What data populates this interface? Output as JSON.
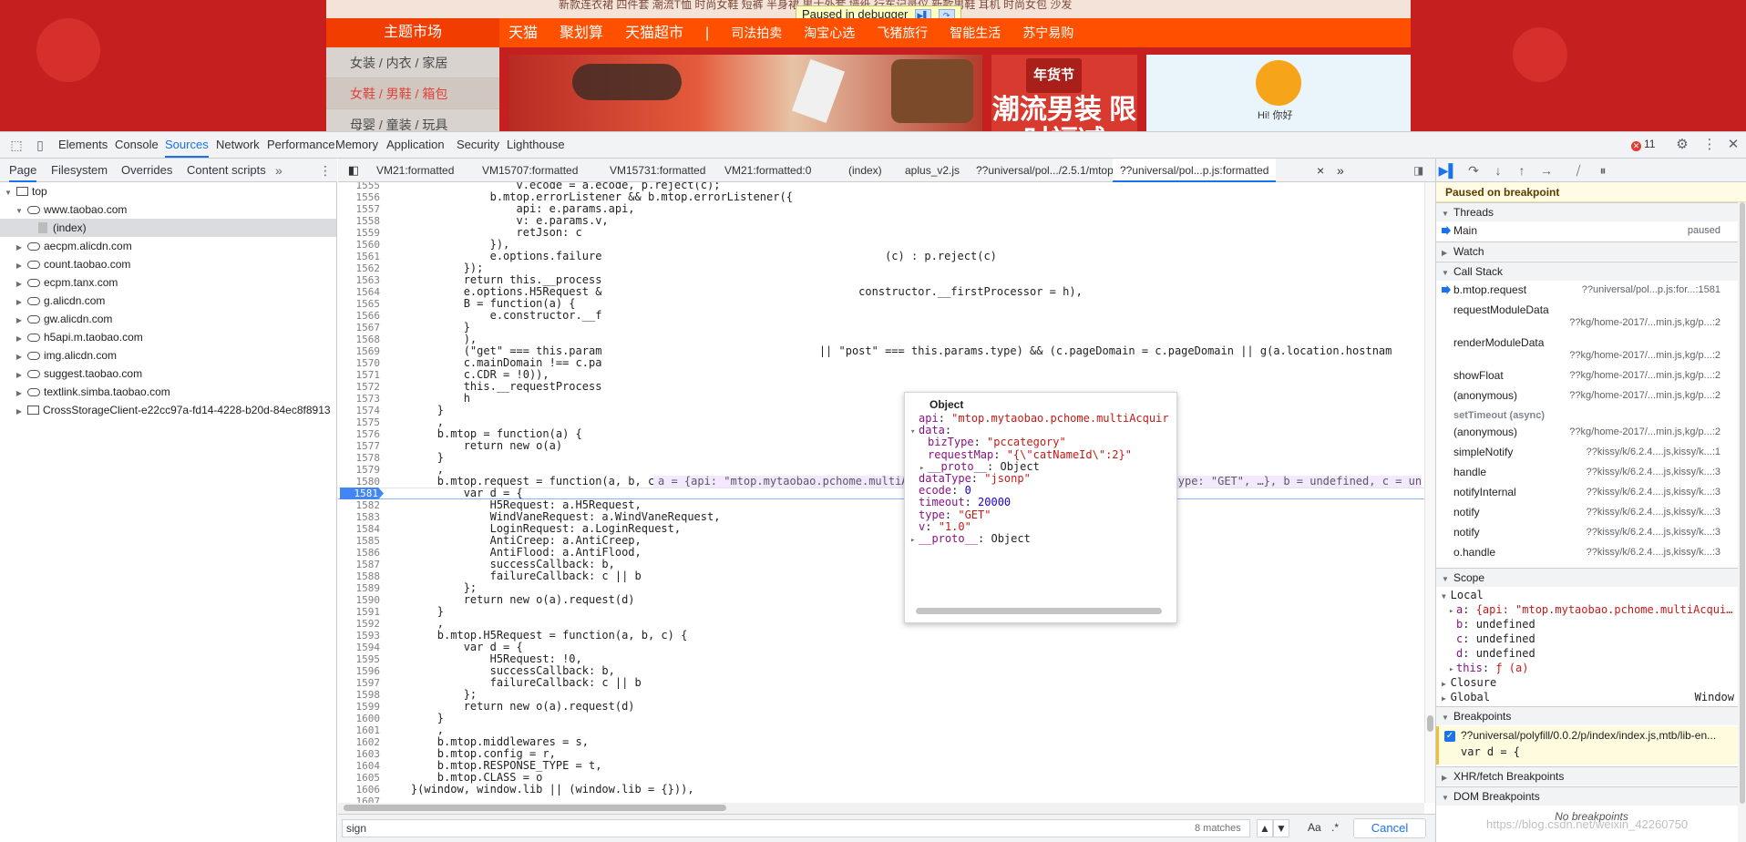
{
  "site": {
    "top_text": "新款连衣裙 四件套 潮流T恤 时尚女鞋 短裤 半身裙 男士外套 墙纸 行车记录仪 新款男鞋 耳机 时尚女包 沙发",
    "debugger_banner": "Paused in debugger",
    "theme_market": "主题市场",
    "nav_items": [
      "天猫",
      "聚划算",
      "天猫超市",
      "|",
      "司法拍卖",
      "淘宝心选",
      "飞猪旅行",
      "智能生活",
      "苏宁易购"
    ],
    "categories": [
      "女装 / 内衣 / 家居",
      "女鞋 / 男鞋 / 箱包",
      "母婴 / 童装 / 玩具"
    ],
    "banner2_tag": "年货节",
    "banner2_text": "潮流男装 限时福减",
    "banner3_hi": "Hi! 你好"
  },
  "devtools": {
    "tabs": [
      "Elements",
      "Console",
      "Sources",
      "Network",
      "Performance",
      "Memory",
      "Application",
      "Security",
      "Lighthouse"
    ],
    "selected_tab": "Sources",
    "error_count": "11",
    "navigator_tabs": [
      "Page",
      "Filesystem",
      "Overrides",
      "Content scripts"
    ],
    "tree": [
      {
        "label": "top",
        "depth": 0,
        "kind": "frame",
        "open": true
      },
      {
        "label": "www.taobao.com",
        "depth": 1,
        "kind": "cloud",
        "open": true
      },
      {
        "label": "(index)",
        "depth": 2,
        "kind": "file",
        "selected": true
      },
      {
        "label": "aecpm.alicdn.com",
        "depth": 1,
        "kind": "cloud"
      },
      {
        "label": "count.taobao.com",
        "depth": 1,
        "kind": "cloud"
      },
      {
        "label": "ecpm.tanx.com",
        "depth": 1,
        "kind": "cloud"
      },
      {
        "label": "g.alicdn.com",
        "depth": 1,
        "kind": "cloud"
      },
      {
        "label": "gw.alicdn.com",
        "depth": 1,
        "kind": "cloud"
      },
      {
        "label": "h5api.m.taobao.com",
        "depth": 1,
        "kind": "cloud"
      },
      {
        "label": "img.alicdn.com",
        "depth": 1,
        "kind": "cloud"
      },
      {
        "label": "suggest.taobao.com",
        "depth": 1,
        "kind": "cloud"
      },
      {
        "label": "textlink.simba.taobao.com",
        "depth": 1,
        "kind": "cloud"
      },
      {
        "label": "CrossStorageClient-e22cc97a-fd14-4228-b20d-84ec8f8913",
        "depth": 1,
        "kind": "frame"
      }
    ],
    "editor_tabs": [
      "VM21:formatted",
      "VM15707:formatted",
      "VM15731:formatted",
      "VM21:formatted:0",
      "(index)",
      "aplus_v2.js",
      "??universal/pol.../2.5.1/mtop.js",
      "??universal/pol...p.js:formatted"
    ],
    "selected_editor_tab": "??universal/pol...p.js:formatted",
    "code_lines": [
      {
        "n": "1555",
        "t": "                    v.ecode = a.ecode, p.reject(c);"
      },
      {
        "n": "1556",
        "t": "                b.mtop.errorListener && b.mtop.errorListener({"
      },
      {
        "n": "1557",
        "t": "                    api: e.params.api,"
      },
      {
        "n": "1558",
        "t": "                    v: e.params.v,"
      },
      {
        "n": "1559",
        "t": "                    retJson: c"
      },
      {
        "n": "1560",
        "t": "                }),"
      },
      {
        "n": "1561",
        "t": "                e.options.failure                                           (c) : p.reject(c)"
      },
      {
        "n": "1562",
        "t": "            });"
      },
      {
        "n": "1563",
        "t": "            return this.__process"
      },
      {
        "n": "1564",
        "t": "            e.options.H5Request &                                       constructor.__firstProcessor = h),"
      },
      {
        "n": "1565",
        "t": "            B = function(a) {"
      },
      {
        "n": "1566",
        "t": "                e.constructor.__f"
      },
      {
        "n": "1567",
        "t": "            }"
      },
      {
        "n": "1568",
        "t": "            ),"
      },
      {
        "n": "1569",
        "t": "            (\"get\" === this.param                                 || \"post\" === this.params.type) && (c.pageDomain = c.pageDomain || g(a.location.hostnam"
      },
      {
        "n": "1570",
        "t": "            c.mainDomain !== c.pa"
      },
      {
        "n": "1571",
        "t": "            c.CDR = !0)),"
      },
      {
        "n": "1572",
        "t": "            this.__requestProcess"
      },
      {
        "n": "1573",
        "t": "            h"
      },
      {
        "n": "1574",
        "t": "        }"
      },
      {
        "n": "1575",
        "t": "        ,"
      },
      {
        "n": "1576",
        "t": "        b.mtop = function(a) {"
      },
      {
        "n": "1577",
        "t": "            return new o(a)"
      },
      {
        "n": "1578",
        "t": "        }"
      },
      {
        "n": "1579",
        "t": "        ,"
      },
      {
        "n": "1580",
        "t": "        b.mtop.request = function(a, b, c) {"
      },
      {
        "n": "1581",
        "t": "            var d = {"
      },
      {
        "n": "1582",
        "t": "                H5Request: a.H5Request,"
      },
      {
        "n": "1583",
        "t": "                WindVaneRequest: a.WindVaneRequest,"
      },
      {
        "n": "1584",
        "t": "                LoginRequest: a.LoginRequest,"
      },
      {
        "n": "1585",
        "t": "                AntiCreep: a.AntiCreep,"
      },
      {
        "n": "1586",
        "t": "                AntiFlood: a.AntiFlood,"
      },
      {
        "n": "1587",
        "t": "                successCallback: b,"
      },
      {
        "n": "1588",
        "t": "                failureCallback: c || b"
      },
      {
        "n": "1589",
        "t": "            };"
      },
      {
        "n": "1590",
        "t": "            return new o(a).request(d)"
      },
      {
        "n": "1591",
        "t": "        }"
      },
      {
        "n": "1592",
        "t": "        ,"
      },
      {
        "n": "1593",
        "t": "        b.mtop.H5Request = function(a, b, c) {"
      },
      {
        "n": "1594",
        "t": "            var d = {"
      },
      {
        "n": "1595",
        "t": "                H5Request: !0,"
      },
      {
        "n": "1596",
        "t": "                successCallback: b,"
      },
      {
        "n": "1597",
        "t": "                failureCallback: c || b"
      },
      {
        "n": "1598",
        "t": "            };"
      },
      {
        "n": "1599",
        "t": "            return new o(a).request(d)"
      },
      {
        "n": "1600",
        "t": "        }"
      },
      {
        "n": "1601",
        "t": "        ,"
      },
      {
        "n": "1602",
        "t": "        b.mtop.middlewares = s,"
      },
      {
        "n": "1603",
        "t": "        b.mtop.config = r,"
      },
      {
        "n": "1604",
        "t": "        b.mtop.RESPONSE_TYPE = t,"
      },
      {
        "n": "1605",
        "t": "        b.mtop.CLASS = o"
      },
      {
        "n": "1606",
        "t": "    }(window, window.lib || (window.lib = {})),"
      },
      {
        "n": "1607",
        "t": ""
      }
    ],
    "current_line": "1581",
    "inline_value": "a = {api: \"mtop.mytaobao.pchome.multiAcquire\", v: \"1.0\", data: {…}, ecode: 0, type: \"GET\", …}, b = undefined, c = un",
    "popup": {
      "title": "Object",
      "rows": [
        {
          "k": "api",
          "v": "\"mtop.mytaobao.pchome.multiAcquir",
          "type": "s",
          "indent": 0
        },
        {
          "k": "data",
          "v": "",
          "type": "k",
          "indent": 0,
          "tri": "▾"
        },
        {
          "k": "bizType",
          "v": "\"pccategory\"",
          "type": "s",
          "indent": 1
        },
        {
          "k": "requestMap",
          "v": "\"{\\\"catNameId\\\":2}\"",
          "type": "s",
          "indent": 1
        },
        {
          "k": "__proto__",
          "v": "Object",
          "type": "o",
          "indent": 1,
          "tri": "▸"
        },
        {
          "k": "dataType",
          "v": "\"jsonp\"",
          "type": "s",
          "indent": 0
        },
        {
          "k": "ecode",
          "v": "0",
          "type": "n",
          "indent": 0
        },
        {
          "k": "timeout",
          "v": "20000",
          "type": "n",
          "indent": 0
        },
        {
          "k": "type",
          "v": "\"GET\"",
          "type": "s",
          "indent": 0
        },
        {
          "k": "v",
          "v": "\"1.0\"",
          "type": "s",
          "indent": 0
        },
        {
          "k": "__proto__",
          "v": "Object",
          "type": "o",
          "indent": 0,
          "tri": "▸"
        }
      ]
    },
    "search": {
      "query": "sign",
      "matches": "8 matches",
      "aa": "Aa",
      "regex": ".*",
      "cancel": "Cancel"
    },
    "debugger": {
      "paused_label": "Paused on breakpoint",
      "sections": {
        "threads": "Threads",
        "watch": "Watch",
        "callstack": "Call Stack",
        "scope": "Scope",
        "breakpoints": "Breakpoints",
        "xhr": "XHR/fetch Breakpoints",
        "dom": "DOM Breakpoints"
      },
      "thread": {
        "name": "Main",
        "status": "paused"
      },
      "call_stack": [
        {
          "fn": "b.mtop.request",
          "loc": "??universal/pol...p.js:for...:1581",
          "active": true
        },
        {
          "fn": "requestModuleData",
          "loc": "??kg/home-2017/...min.js,kg/p...:2",
          "two": true
        },
        {
          "fn": "renderModuleData",
          "loc": "??kg/home-2017/...min.js,kg/p...:2",
          "two": true
        },
        {
          "fn": "showFloat",
          "loc": "??kg/home-2017/...min.js,kg/p...:2"
        },
        {
          "fn": "(anonymous)",
          "loc": "??kg/home-2017/...min.js,kg/p...:2"
        },
        {
          "fn": "setTimeout (async)",
          "loc": "",
          "async": true
        },
        {
          "fn": "(anonymous)",
          "loc": "??kg/home-2017/...min.js,kg/p...:2"
        },
        {
          "fn": "simpleNotify",
          "loc": "??kissy/k/6.2.4....js,kissy/k...:1"
        },
        {
          "fn": "handle",
          "loc": "??kissy/k/6.2.4....js,kissy/k...:3"
        },
        {
          "fn": "notifyInternal",
          "loc": "??kissy/k/6.2.4....js,kissy/k...:3"
        },
        {
          "fn": "notify",
          "loc": "??kissy/k/6.2.4....js,kissy/k...:3"
        },
        {
          "fn": "notify",
          "loc": "??kissy/k/6.2.4....js,kissy/k...:3"
        },
        {
          "fn": "o.handle",
          "loc": "??kissy/k/6.2.4....js,kissy/k...:3"
        }
      ],
      "scope": {
        "local_label": "Local",
        "local": [
          {
            "k": "a",
            "v": "{api: \"mtop.mytaobao.pchome.multiAcqui…",
            "tri": "▸"
          },
          {
            "k": "b",
            "v": "undefined"
          },
          {
            "k": "c",
            "v": "undefined"
          },
          {
            "k": "d",
            "v": "undefined"
          },
          {
            "k": "this",
            "v": "ƒ (a)",
            "tri": "▸"
          }
        ],
        "closure": "Closure",
        "global": "Global",
        "global_value": "Window"
      },
      "breakpoint": {
        "file": "??universal/polyfill/0.0.2/p/index/index.js,mtb/lib-en...",
        "code": "var d = {"
      },
      "no_breakpoints": "No breakpoints"
    },
    "watermark": "https://blog.csdn.net/weixin_42260750"
  },
  "colors": {
    "accent": "#1a73e8",
    "site_red": "#c51f1f",
    "nav_orange": "#ff5000",
    "paused_bg": "#fffbe5"
  }
}
